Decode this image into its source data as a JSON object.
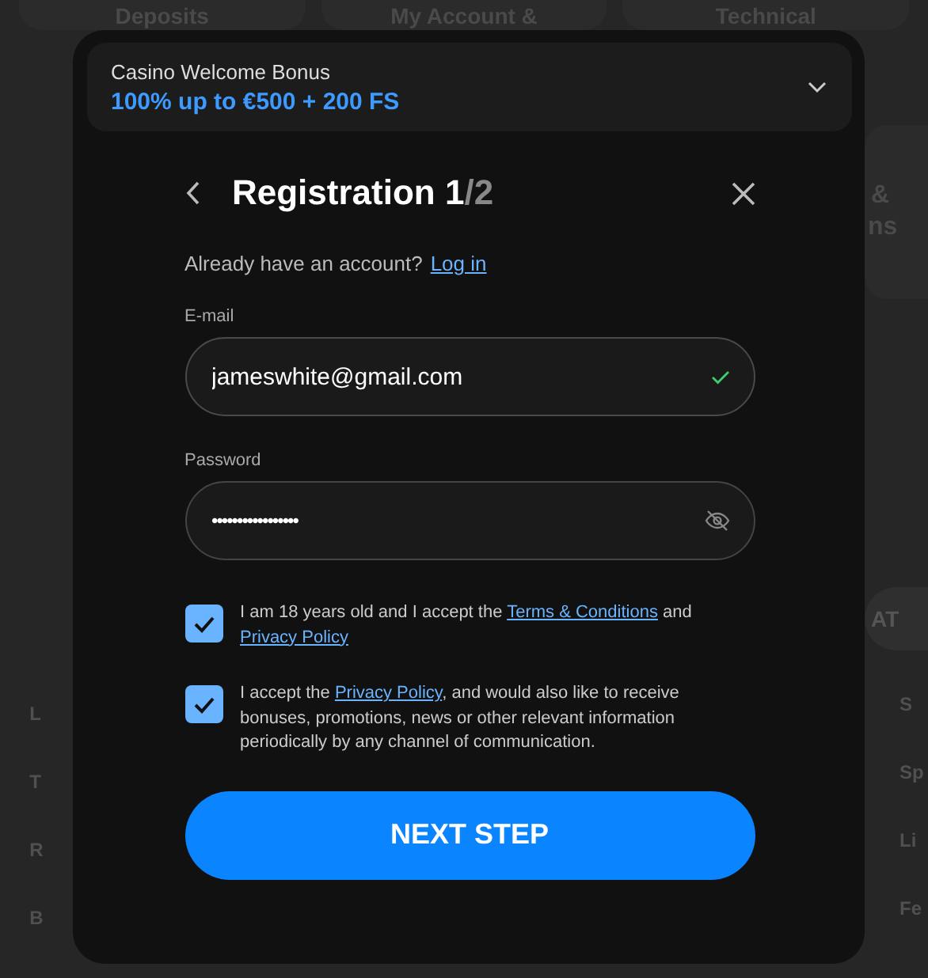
{
  "background": {
    "top_cards": [
      "Deposits",
      "My Account &",
      "Technical"
    ],
    "right_card_lines": [
      "&",
      "ns"
    ],
    "right_button": "AT",
    "left_links": [
      "L",
      "T",
      "R",
      "B"
    ],
    "right_links": [
      "S",
      "Sp",
      "Li",
      "Fe"
    ]
  },
  "bonus": {
    "title": "Casino Welcome Bonus",
    "offer": "100% up to €500 + 200 FS",
    "expanded": false
  },
  "header": {
    "title": "Registration 1",
    "step_total": "/2"
  },
  "login_prompt": {
    "text": "Already have an account?",
    "link": "Log in"
  },
  "fields": [
    {
      "label": "E-mail",
      "value": "jameswhite@gmail.com",
      "kind": "email",
      "valid": true
    },
    {
      "label": "Password",
      "value": "•••••••••••••••••",
      "kind": "password"
    }
  ],
  "consents": [
    {
      "parts": [
        {
          "text": "I am 18 years old and I accept the "
        },
        {
          "text": "Terms & Conditions",
          "link": true
        },
        {
          "text": " and "
        },
        {
          "text": "Privacy Policy",
          "link": true
        }
      ],
      "checked": true
    },
    {
      "parts": [
        {
          "text": "I accept the "
        },
        {
          "text": "Privacy Policy",
          "link": true
        },
        {
          "text": ", and would also like to receive bonuses, promotions, news or other relevant information periodically by any channel of communication."
        }
      ],
      "checked": true
    }
  ],
  "submit": "NEXT STEP"
}
